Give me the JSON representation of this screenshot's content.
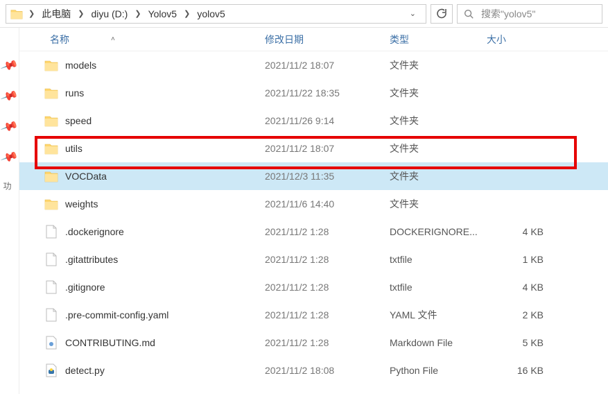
{
  "breadcrumb": {
    "items": [
      "此电脑",
      "diyu (D:)",
      "Yolov5",
      "yolov5"
    ]
  },
  "search": {
    "placeholder": "搜索\"yolov5\""
  },
  "columns": {
    "name": "名称",
    "date": "修改日期",
    "type": "类型",
    "size": "大小"
  },
  "sidebar": {
    "tab_label": "功"
  },
  "items": [
    {
      "icon": "folder",
      "name": "models",
      "date": "2021/11/2 18:07",
      "type": "文件夹",
      "size": "",
      "selected": false
    },
    {
      "icon": "folder",
      "name": "runs",
      "date": "2021/11/22 18:35",
      "type": "文件夹",
      "size": "",
      "selected": false
    },
    {
      "icon": "folder",
      "name": "speed",
      "date": "2021/11/26 9:14",
      "type": "文件夹",
      "size": "",
      "selected": false
    },
    {
      "icon": "folder",
      "name": "utils",
      "date": "2021/11/2 18:07",
      "type": "文件夹",
      "size": "",
      "selected": false
    },
    {
      "icon": "folder",
      "name": "VOCData",
      "date": "2021/12/3 11:35",
      "type": "文件夹",
      "size": "",
      "selected": true
    },
    {
      "icon": "folder",
      "name": "weights",
      "date": "2021/11/6 14:40",
      "type": "文件夹",
      "size": "",
      "selected": false
    },
    {
      "icon": "file",
      "name": ".dockerignore",
      "date": "2021/11/2 1:28",
      "type": "DOCKERIGNORE...",
      "size": "4 KB",
      "selected": false
    },
    {
      "icon": "file",
      "name": ".gitattributes",
      "date": "2021/11/2 1:28",
      "type": "txtfile",
      "size": "1 KB",
      "selected": false
    },
    {
      "icon": "file",
      "name": ".gitignore",
      "date": "2021/11/2 1:28",
      "type": "txtfile",
      "size": "4 KB",
      "selected": false
    },
    {
      "icon": "file",
      "name": ".pre-commit-config.yaml",
      "date": "2021/11/2 1:28",
      "type": "YAML 文件",
      "size": "2 KB",
      "selected": false
    },
    {
      "icon": "md",
      "name": "CONTRIBUTING.md",
      "date": "2021/11/2 1:28",
      "type": "Markdown File",
      "size": "5 KB",
      "selected": false
    },
    {
      "icon": "py",
      "name": "detect.py",
      "date": "2021/11/2 18:08",
      "type": "Python File",
      "size": "16 KB",
      "selected": false
    }
  ]
}
